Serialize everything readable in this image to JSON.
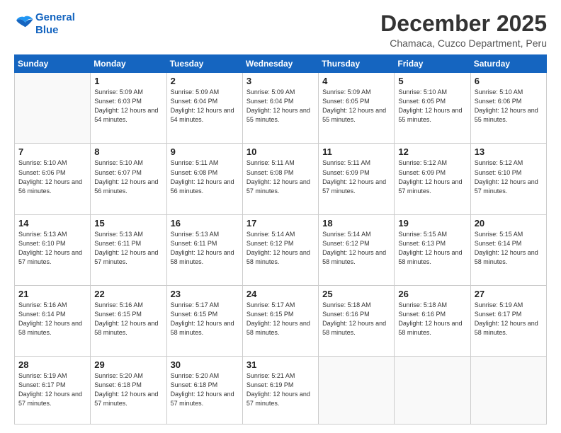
{
  "logo": {
    "line1": "General",
    "line2": "Blue"
  },
  "header": {
    "month": "December 2025",
    "location": "Chamaca, Cuzco Department, Peru"
  },
  "weekdays": [
    "Sunday",
    "Monday",
    "Tuesday",
    "Wednesday",
    "Thursday",
    "Friday",
    "Saturday"
  ],
  "weeks": [
    [
      {
        "day": "",
        "sunrise": "",
        "sunset": "",
        "daylight": ""
      },
      {
        "day": "1",
        "sunrise": "Sunrise: 5:09 AM",
        "sunset": "Sunset: 6:03 PM",
        "daylight": "Daylight: 12 hours and 54 minutes."
      },
      {
        "day": "2",
        "sunrise": "Sunrise: 5:09 AM",
        "sunset": "Sunset: 6:04 PM",
        "daylight": "Daylight: 12 hours and 54 minutes."
      },
      {
        "day": "3",
        "sunrise": "Sunrise: 5:09 AM",
        "sunset": "Sunset: 6:04 PM",
        "daylight": "Daylight: 12 hours and 55 minutes."
      },
      {
        "day": "4",
        "sunrise": "Sunrise: 5:09 AM",
        "sunset": "Sunset: 6:05 PM",
        "daylight": "Daylight: 12 hours and 55 minutes."
      },
      {
        "day": "5",
        "sunrise": "Sunrise: 5:10 AM",
        "sunset": "Sunset: 6:05 PM",
        "daylight": "Daylight: 12 hours and 55 minutes."
      },
      {
        "day": "6",
        "sunrise": "Sunrise: 5:10 AM",
        "sunset": "Sunset: 6:06 PM",
        "daylight": "Daylight: 12 hours and 55 minutes."
      }
    ],
    [
      {
        "day": "7",
        "sunrise": "Sunrise: 5:10 AM",
        "sunset": "Sunset: 6:06 PM",
        "daylight": "Daylight: 12 hours and 56 minutes."
      },
      {
        "day": "8",
        "sunrise": "Sunrise: 5:10 AM",
        "sunset": "Sunset: 6:07 PM",
        "daylight": "Daylight: 12 hours and 56 minutes."
      },
      {
        "day": "9",
        "sunrise": "Sunrise: 5:11 AM",
        "sunset": "Sunset: 6:08 PM",
        "daylight": "Daylight: 12 hours and 56 minutes."
      },
      {
        "day": "10",
        "sunrise": "Sunrise: 5:11 AM",
        "sunset": "Sunset: 6:08 PM",
        "daylight": "Daylight: 12 hours and 57 minutes."
      },
      {
        "day": "11",
        "sunrise": "Sunrise: 5:11 AM",
        "sunset": "Sunset: 6:09 PM",
        "daylight": "Daylight: 12 hours and 57 minutes."
      },
      {
        "day": "12",
        "sunrise": "Sunrise: 5:12 AM",
        "sunset": "Sunset: 6:09 PM",
        "daylight": "Daylight: 12 hours and 57 minutes."
      },
      {
        "day": "13",
        "sunrise": "Sunrise: 5:12 AM",
        "sunset": "Sunset: 6:10 PM",
        "daylight": "Daylight: 12 hours and 57 minutes."
      }
    ],
    [
      {
        "day": "14",
        "sunrise": "Sunrise: 5:13 AM",
        "sunset": "Sunset: 6:10 PM",
        "daylight": "Daylight: 12 hours and 57 minutes."
      },
      {
        "day": "15",
        "sunrise": "Sunrise: 5:13 AM",
        "sunset": "Sunset: 6:11 PM",
        "daylight": "Daylight: 12 hours and 57 minutes."
      },
      {
        "day": "16",
        "sunrise": "Sunrise: 5:13 AM",
        "sunset": "Sunset: 6:11 PM",
        "daylight": "Daylight: 12 hours and 58 minutes."
      },
      {
        "day": "17",
        "sunrise": "Sunrise: 5:14 AM",
        "sunset": "Sunset: 6:12 PM",
        "daylight": "Daylight: 12 hours and 58 minutes."
      },
      {
        "day": "18",
        "sunrise": "Sunrise: 5:14 AM",
        "sunset": "Sunset: 6:12 PM",
        "daylight": "Daylight: 12 hours and 58 minutes."
      },
      {
        "day": "19",
        "sunrise": "Sunrise: 5:15 AM",
        "sunset": "Sunset: 6:13 PM",
        "daylight": "Daylight: 12 hours and 58 minutes."
      },
      {
        "day": "20",
        "sunrise": "Sunrise: 5:15 AM",
        "sunset": "Sunset: 6:14 PM",
        "daylight": "Daylight: 12 hours and 58 minutes."
      }
    ],
    [
      {
        "day": "21",
        "sunrise": "Sunrise: 5:16 AM",
        "sunset": "Sunset: 6:14 PM",
        "daylight": "Daylight: 12 hours and 58 minutes."
      },
      {
        "day": "22",
        "sunrise": "Sunrise: 5:16 AM",
        "sunset": "Sunset: 6:15 PM",
        "daylight": "Daylight: 12 hours and 58 minutes."
      },
      {
        "day": "23",
        "sunrise": "Sunrise: 5:17 AM",
        "sunset": "Sunset: 6:15 PM",
        "daylight": "Daylight: 12 hours and 58 minutes."
      },
      {
        "day": "24",
        "sunrise": "Sunrise: 5:17 AM",
        "sunset": "Sunset: 6:15 PM",
        "daylight": "Daylight: 12 hours and 58 minutes."
      },
      {
        "day": "25",
        "sunrise": "Sunrise: 5:18 AM",
        "sunset": "Sunset: 6:16 PM",
        "daylight": "Daylight: 12 hours and 58 minutes."
      },
      {
        "day": "26",
        "sunrise": "Sunrise: 5:18 AM",
        "sunset": "Sunset: 6:16 PM",
        "daylight": "Daylight: 12 hours and 58 minutes."
      },
      {
        "day": "27",
        "sunrise": "Sunrise: 5:19 AM",
        "sunset": "Sunset: 6:17 PM",
        "daylight": "Daylight: 12 hours and 58 minutes."
      }
    ],
    [
      {
        "day": "28",
        "sunrise": "Sunrise: 5:19 AM",
        "sunset": "Sunset: 6:17 PM",
        "daylight": "Daylight: 12 hours and 57 minutes."
      },
      {
        "day": "29",
        "sunrise": "Sunrise: 5:20 AM",
        "sunset": "Sunset: 6:18 PM",
        "daylight": "Daylight: 12 hours and 57 minutes."
      },
      {
        "day": "30",
        "sunrise": "Sunrise: 5:20 AM",
        "sunset": "Sunset: 6:18 PM",
        "daylight": "Daylight: 12 hours and 57 minutes."
      },
      {
        "day": "31",
        "sunrise": "Sunrise: 5:21 AM",
        "sunset": "Sunset: 6:19 PM",
        "daylight": "Daylight: 12 hours and 57 minutes."
      },
      {
        "day": "",
        "sunrise": "",
        "sunset": "",
        "daylight": ""
      },
      {
        "day": "",
        "sunrise": "",
        "sunset": "",
        "daylight": ""
      },
      {
        "day": "",
        "sunrise": "",
        "sunset": "",
        "daylight": ""
      }
    ]
  ]
}
